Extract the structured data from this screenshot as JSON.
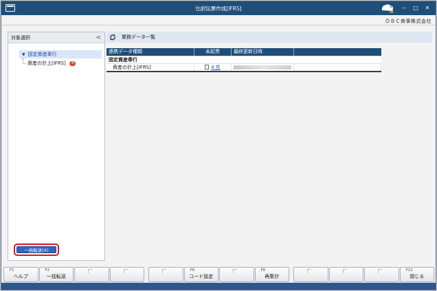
{
  "window": {
    "title": "仕訳伝票作成[IFRS]",
    "company": "ＯＢＣ商事株式会社",
    "ai_badge": "AI",
    "minimize": "‒",
    "maximize": "□",
    "close": "✕"
  },
  "left_panel": {
    "title": "対象選択",
    "collapse": "<",
    "tree": {
      "root": "固定資産奉行",
      "child": "資産の計上[IFRS]",
      "child_badge": "4"
    },
    "bulk_button": "一括転送(X)"
  },
  "main": {
    "title": "業務データ一覧",
    "table": {
      "headers": [
        "連携データ種類",
        "未起票",
        "最終更新日時",
        ""
      ],
      "group": "固定資産奉行",
      "rows": [
        {
          "name": "資産の計上[IFRS]",
          "pending": "4 件",
          "updated": ""
        }
      ]
    }
  },
  "fkeys": [
    {
      "key": "F1",
      "label": "ヘルプ"
    },
    {
      "key": "F2",
      "label": "一括転送"
    },
    {
      "key": "",
      "label": ""
    },
    {
      "key": "",
      "label": ""
    },
    {
      "key": "",
      "label": ""
    },
    {
      "key": "F6",
      "label": "コード設定"
    },
    {
      "key": "",
      "label": ""
    },
    {
      "key": "F8",
      "label": "再集計"
    },
    {
      "key": "",
      "label": ""
    },
    {
      "key": "",
      "label": ""
    },
    {
      "key": "",
      "label": ""
    },
    {
      "key": "F12",
      "label": "閉じる"
    }
  ],
  "colors": {
    "titlebar": "#1f4e79",
    "accent": "#2f64c4",
    "highlight": "#cc1a1a",
    "badge": "#d24b2a"
  }
}
